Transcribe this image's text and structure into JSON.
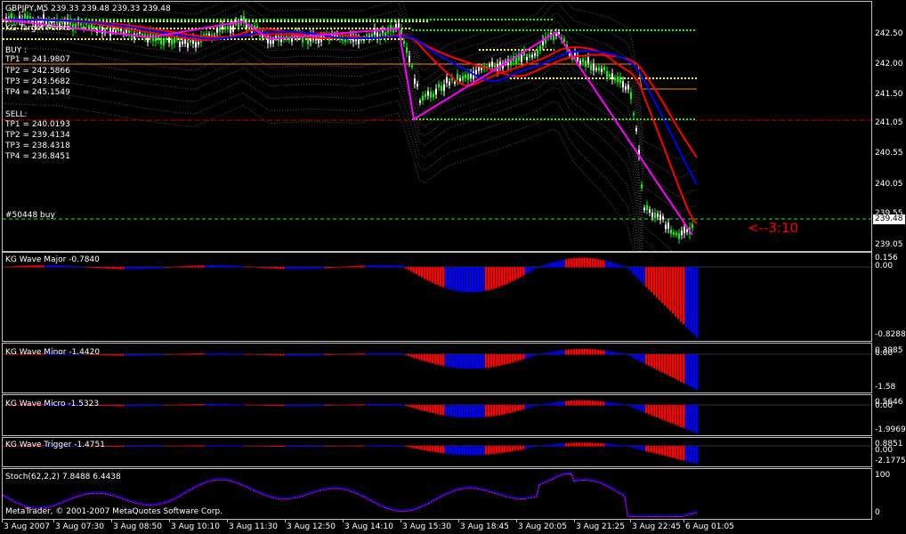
{
  "window": {
    "symbol_header": "GBPJPY,M5  239.33 239.48 239.33 239.48",
    "copyright": "MetaTrader, © 2001-2007 MetaQuotes Software Corp."
  },
  "main_chart": {
    "target_label": "KG Target Points",
    "buy_header": "BUY :",
    "buy_tps": [
      "TP1 = 241.9807",
      "TP2 = 242.5866",
      "TP3 = 243.5682",
      "TP4 = 245.1549"
    ],
    "sell_header": "SELL:",
    "sell_tps": [
      "TP1 = 240.0193",
      "TP2 = 239.4134",
      "TP3 = 238.4318",
      "TP4 = 236.8451"
    ],
    "order_label": "#50448 buy",
    "annotation": "<--3:10",
    "current_price": "239.48",
    "price_ticks": [
      "242.50",
      "242.00",
      "241.50",
      "241.05",
      "240.55",
      "240.05",
      "239.55",
      "239.05"
    ],
    "colors": {
      "up_candle": "#00ff00",
      "ma_red": "#ff0000",
      "ma_blue": "#0000ff",
      "zigzag": "#ff00ff",
      "level_yellow": "#ffff00",
      "level_green": "#00ff00",
      "level_orange": "#ff8c00"
    }
  },
  "indicators": [
    {
      "title": "KG Wave Major  -0.7840",
      "ticks": [
        "0.156",
        "0.00",
        "-0.8288"
      ]
    },
    {
      "title": "KG Wave Minor  -1.4420",
      "ticks": [
        "0.3985",
        "0.00",
        "-1.58"
      ]
    },
    {
      "title": "KG Wave Micro  -1.5323",
      "ticks": [
        "0.5646",
        "0.00",
        "-1.9969"
      ]
    },
    {
      "title": "KG Wave Trigger  -1.4751",
      "ticks": [
        "0.8851",
        "0.00",
        "-2.1775"
      ]
    },
    {
      "title": "Stoch(62,2,2) 7.8488 6.4438",
      "ticks": [
        "100",
        "0"
      ]
    }
  ],
  "time_axis": [
    "3 Aug 2007",
    "3 Aug 07:30",
    "3 Aug 08:50",
    "3 Aug 10:10",
    "3 Aug 11:30",
    "3 Aug 12:50",
    "3 Aug 14:10",
    "3 Aug 15:30",
    "3 Aug 18:45",
    "3 Aug 20:05",
    "3 Aug 21:25",
    "3 Aug 22:45",
    "6 Aug 01:05"
  ]
}
